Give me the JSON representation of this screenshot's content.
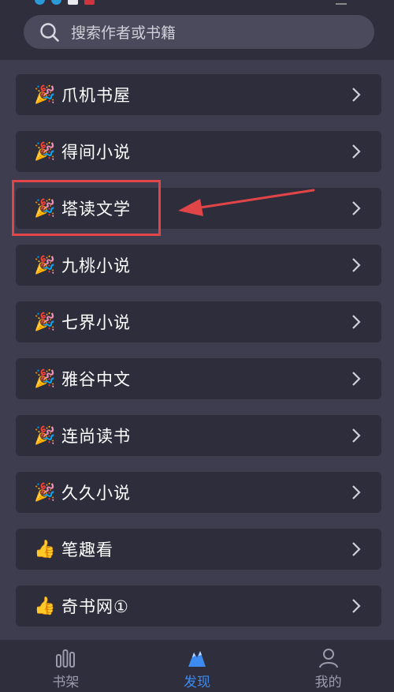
{
  "search": {
    "placeholder": "搜索作者或书籍",
    "icon": "search-icon"
  },
  "sources": [
    {
      "icon": "party-popper-icon",
      "emoji": "🎉",
      "label": "爪机书屋"
    },
    {
      "icon": "party-popper-icon",
      "emoji": "🎉",
      "label": "得间小说"
    },
    {
      "icon": "party-popper-icon",
      "emoji": "🎉",
      "label": "塔读文学"
    },
    {
      "icon": "party-popper-icon",
      "emoji": "🎉",
      "label": "九桃小说"
    },
    {
      "icon": "party-popper-icon",
      "emoji": "🎉",
      "label": "七界小说"
    },
    {
      "icon": "party-popper-icon",
      "emoji": "🎉",
      "label": "雅谷中文"
    },
    {
      "icon": "party-popper-icon",
      "emoji": "🎉",
      "label": "连尚读书"
    },
    {
      "icon": "party-popper-icon",
      "emoji": "🎉",
      "label": "久久小说"
    },
    {
      "icon": "thumbs-up-icon",
      "emoji": "👍",
      "label": "笔趣看"
    },
    {
      "icon": "thumbs-up-icon",
      "emoji": "👍",
      "label": "奇书网①"
    }
  ],
  "annotation": {
    "highlighted_item": "塔读文学",
    "color": "#e24548"
  },
  "bottom_nav": [
    {
      "icon": "bookshelf-icon",
      "label": "书架",
      "active": false
    },
    {
      "icon": "discover-icon",
      "label": "发现",
      "active": true
    },
    {
      "icon": "profile-icon",
      "label": "我的",
      "active": false
    }
  ],
  "colors": {
    "background": "#3e3d4f",
    "item_bg": "#2e2d3c",
    "accent": "#3d8bf0"
  }
}
